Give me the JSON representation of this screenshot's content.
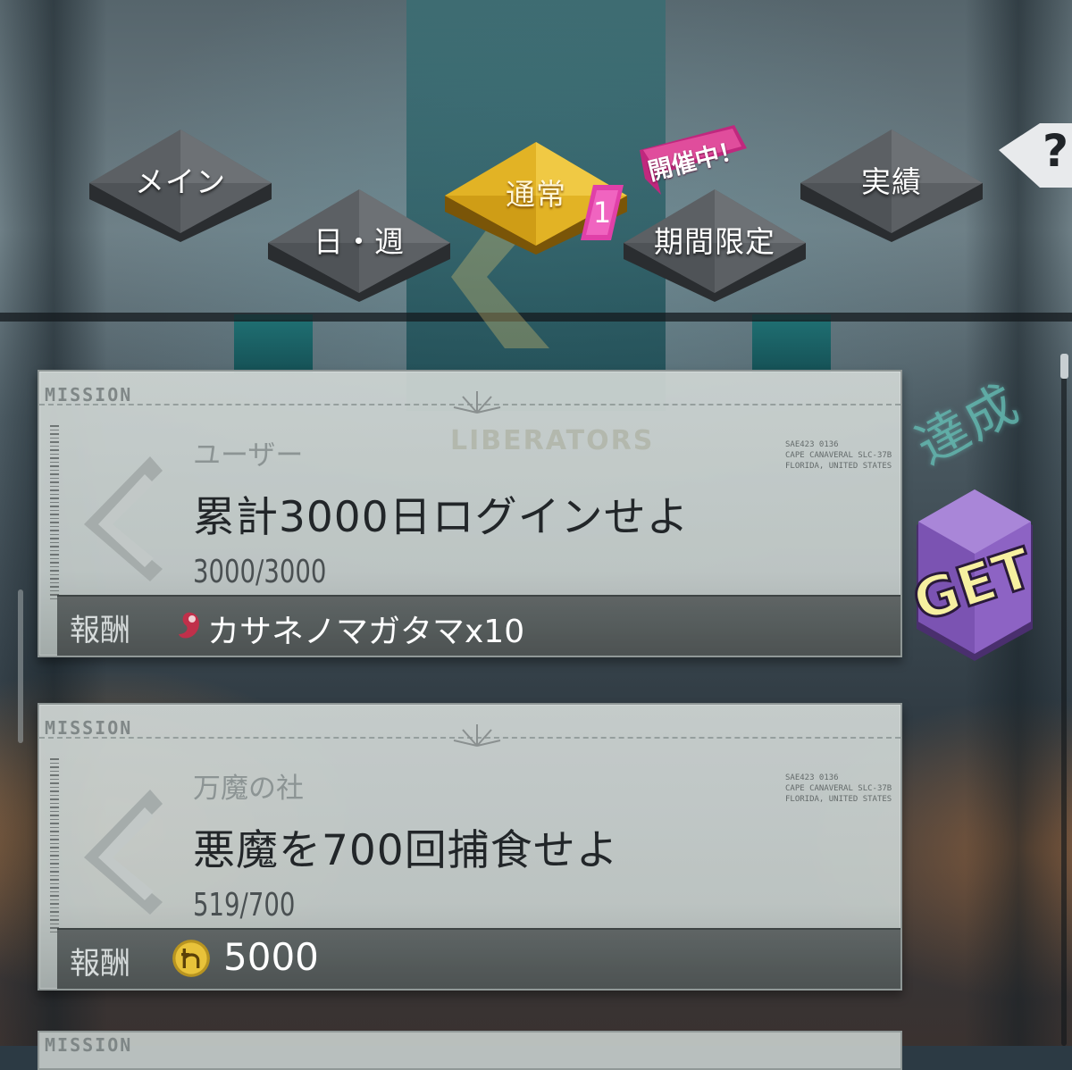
{
  "tabs": [
    {
      "id": "main",
      "label": "メイン",
      "active": false
    },
    {
      "id": "daily_weekly",
      "label": "日・週",
      "active": false
    },
    {
      "id": "normal",
      "label": "通常",
      "active": true
    },
    {
      "id": "limited",
      "label": "期間限定",
      "active": false
    },
    {
      "id": "achievement",
      "label": "実績",
      "active": false
    }
  ],
  "badges": {
    "normal_count": "1",
    "limited_event": "開催中！"
  },
  "help_label": "?",
  "missions": [
    {
      "stamp": "MISSION",
      "watermark": "LIBERATORS",
      "category": "ユーザー",
      "title": "累計3000日ログインせよ",
      "progress": "3000/3000",
      "reward_label": "報酬",
      "reward_icon": "magatama-icon",
      "reward": "カサネノマガタマx10",
      "status": "達成",
      "action": "GET"
    },
    {
      "stamp": "MISSION",
      "category": "万魔の社",
      "title": "悪魔を700回捕食せよ",
      "progress": "519/700",
      "reward_label": "報酬",
      "reward_icon": "macca-coin-icon",
      "reward": "5000"
    }
  ],
  "peek_stamp": "MISSION",
  "colors": {
    "active_tab": "#e2b325",
    "inactive_tab": "#5c6064",
    "badge_pink": "#e040a8",
    "get_button": "#8d63c4"
  }
}
